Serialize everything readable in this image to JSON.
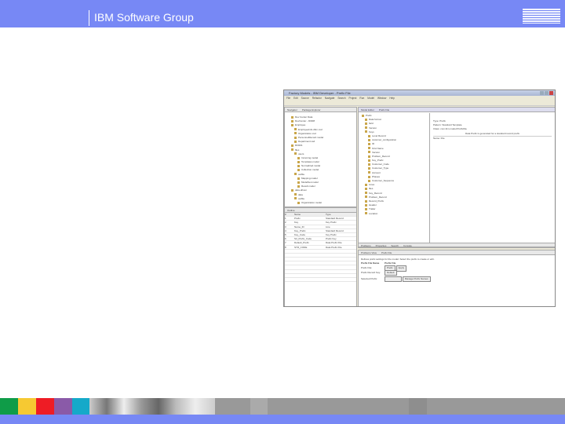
{
  "header": {
    "title": "IBM Software Group",
    "logo": "IBM"
  },
  "footer": {
    "colors": [
      "#0f9c48",
      "#f6c932",
      "#ee1c25",
      "#8a5aa8",
      "#15a9c9"
    ]
  },
  "app": {
    "window_title": "Factory Models - IBM Developer - Prefix File",
    "menu": [
      "File",
      "Edit",
      "Source",
      "Refactor",
      "Navigate",
      "Search",
      "Project",
      "Run",
      "Model",
      "Window",
      "Help"
    ],
    "left_tabs": [
      "Navigator",
      "Package Explorer"
    ],
    "tree": [
      "Dev Center Data",
      "DevCenter - DI008",
      "Employee",
      "EmployeeInfo.dbm.xsd",
      "Organization.xsd",
      "PersonnelRecord.model",
      "Department.xsd",
      "RO001",
      "files",
      "users",
      "Incoming.model",
      "Templates.model",
      "Normalized.model",
      "Collection.model",
      "outfile",
      "Mapping.model",
      "ModelSet.model",
      "Result.model",
      "data-driven",
      "data",
      "outfile",
      "Organization.model"
    ],
    "editor_tabs": [
      "Model Editor",
      "Prefix File"
    ],
    "editor_tree": [
      "Prefix",
      "Data format",
      "field",
      "Version",
      "Keys",
      "Level Record",
      "customer_configuration",
      "ID",
      "First Name",
      "Version",
      "Problem_Record",
      "Key_Prefix",
      "Customer_Code",
      "Customer_Type",
      "Account",
      "Phases",
      "Customer_Sequence",
      "Lines",
      "files",
      "Key_Record",
      "Problem_Record",
      "Record_Prefix",
      "Header",
      "Trailer",
      "Location"
    ],
    "details": {
      "type_label": "Type:",
      "type_value": "Prefix",
      "pattern_label": "Pattern:",
      "pattern_value": "Standard Template",
      "class_label": "Class:",
      "class_value": "com.ibm.model.PrefixFile",
      "note": "Data Prefix is generated for a standard record prefix",
      "name_label": "Name: File"
    },
    "outline": {
      "tab": "Outline",
      "columns": [
        "#",
        "Name",
        "Type"
      ],
      "rows": [
        [
          "1",
          "Prefix",
          "Standard Record"
        ],
        [
          "2",
          "Key",
          "Key Prefix"
        ],
        [
          "3",
          "Name_ID",
          "Line"
        ],
        [
          "4",
          "Key_Prefix",
          "Standard Record"
        ],
        [
          "5",
          "Key_Code",
          "Key Prefix"
        ],
        [
          "6",
          "Str_Prefix_Code",
          "Prefix Key"
        ],
        [
          "7",
          "Default_Prefix",
          "Data Prefix File"
        ],
        [
          "8",
          "STR_CODE",
          "Data Prefix File"
        ]
      ]
    },
    "bottom_tabs": [
      "Problems",
      "Properties",
      "Search",
      "Console"
    ],
    "panel_tabs": [
      "Problems View",
      "Prefix File"
    ],
    "panel": {
      "desc": "Defines prefix settings for the model. Select the prefix to create or edit.",
      "col1": "Prefix File Name",
      "col2": "Prefix File",
      "row1_label": "Prefix File:",
      "row1_value": "Prefix",
      "row2_label": "Prefix Record Key:",
      "row2_value": "Default",
      "apply": "Apply",
      "row3_label": "Selected Prefix:",
      "manage": "Manage Prefix Names"
    }
  }
}
